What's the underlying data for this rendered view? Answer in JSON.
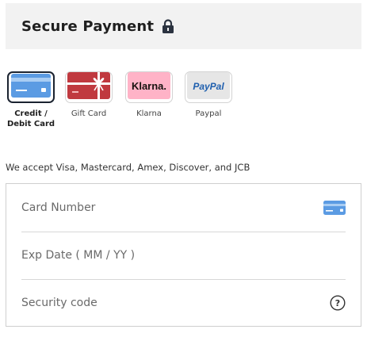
{
  "header": {
    "title": "Secure Payment",
    "icon": "lock-icon"
  },
  "payment_methods": [
    {
      "label": "Credit / Debit Card",
      "icon": "credit-card-icon",
      "selected": true
    },
    {
      "label": "Gift Card",
      "icon": "gift-card-icon",
      "selected": false
    },
    {
      "label": "Klarna",
      "icon": "klarna-logo",
      "tile_text": "Klarna.",
      "selected": false
    },
    {
      "label": "Paypal",
      "icon": "paypal-logo",
      "tile_text": "PayPal",
      "selected": false
    }
  ],
  "accept_text": "We accept Visa, Mastercard, Amex, Discover, and JCB",
  "form": {
    "card_number_placeholder": "Card Number",
    "exp_date_placeholder": "Exp Date ( MM / YY )",
    "security_code_placeholder": "Security code"
  },
  "colors": {
    "header_bg": "#f2f2f2",
    "card_blue": "#5b9be3",
    "gift_red": "#c0393f",
    "klarna_pink": "#ffb3c7",
    "paypal_blue": "#1f5fae"
  }
}
